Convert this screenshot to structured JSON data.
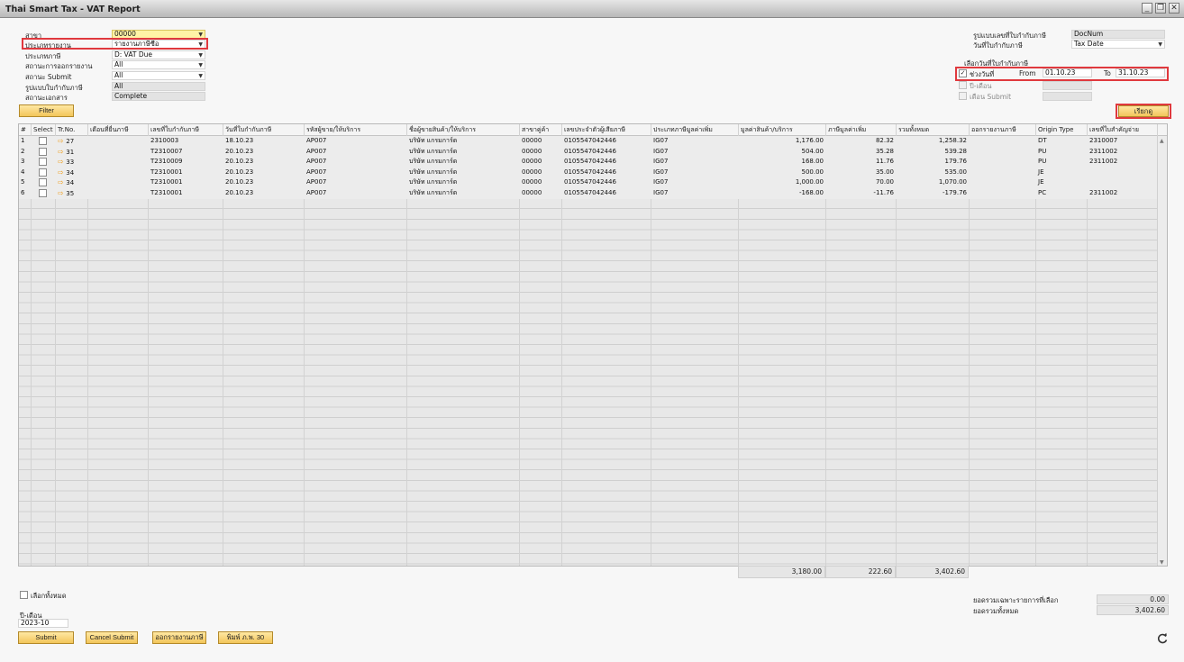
{
  "window": {
    "title": "Thai Smart Tax - VAT Report"
  },
  "left_form": [
    {
      "label": "สาขา",
      "value": "00000",
      "style": "yellow",
      "dropdown": true
    },
    {
      "label": "ประเภทรายงาน",
      "value": "รายงานภาษีซื้อ",
      "style": "white",
      "dropdown": true
    },
    {
      "label": "ประเภทภาษี",
      "value": "D: VAT Due",
      "style": "white",
      "dropdown": true
    },
    {
      "label": "สถานะการออกรายงาน",
      "value": "All",
      "style": "white",
      "dropdown": true
    },
    {
      "label": "สถานะ Submit",
      "value": "All",
      "style": "white",
      "dropdown": true
    },
    {
      "label": "รูปแบบใบกำกับภาษี",
      "value": "All",
      "style": "grey",
      "dropdown": false
    },
    {
      "label": "สถานะเอกสาร",
      "value": "Complete",
      "style": "grey",
      "dropdown": false
    }
  ],
  "right_form": {
    "doc_format_label": "รูปแบบเลขที่ใบกำกับภาษี",
    "doc_format_value": "DocNum",
    "date_label": "วันที่ใบกำกับภาษี",
    "date_value": "Tax Date",
    "select_date_heading": "เลือกวันที่ใบกำกับภาษี",
    "range_label": "ช่วงวันที่",
    "from_label": "From",
    "from_value": "01.10.23",
    "to_label": "To",
    "to_value": "31.10.23",
    "year_month_label": "ปี-เดือน",
    "month_submit_label": "เดือน Submit"
  },
  "buttons": {
    "filter": "Filter",
    "match": "เรียกดู",
    "submit": "Submit",
    "cancel_submit": "Cancel Submit",
    "issue_report": "ออกรายงานภาษี",
    "print_form": "พิมพ์ ภ.พ. 30"
  },
  "table": {
    "columns": [
      "#",
      "Select",
      "Tr.No.",
      "เดือนที่ยื่นภาษี",
      "เลขที่ใบกำกับภาษี",
      "วันที่ใบกำกับภาษี",
      "รหัสผู้ขาย/ให้บริการ",
      "ชื่อผู้ขายสินค้า/ให้บริการ",
      "สาขาคู่ค้า",
      "เลขประจำตัวผู้เสียภาษี",
      "ประเภทภาษีมูลค่าเพิ่ม",
      "มูลค่าสินค้า/บริการ",
      "ภาษีมูลค่าเพิ่ม",
      "รวมทั้งหมด",
      "ออกรายงานภาษี",
      "Origin Type",
      "เลขที่ใบสำคัญจ่าย"
    ],
    "rows": [
      [
        "1",
        "",
        "27",
        "",
        "2310003",
        "18.10.23",
        "AP007",
        "บริษัท แกรมการ์ด",
        "00000",
        "0105547042446",
        "IG07",
        "1,176.00",
        "82.32",
        "1,258.32",
        "",
        "DT",
        "2310007"
      ],
      [
        "2",
        "",
        "31",
        "",
        "T2310007",
        "20.10.23",
        "AP007",
        "บริษัท แกรมการ์ด",
        "00000",
        "0105547042446",
        "IG07",
        "504.00",
        "35.28",
        "539.28",
        "",
        "PU",
        "2311002"
      ],
      [
        "3",
        "",
        "33",
        "",
        "T2310009",
        "20.10.23",
        "AP007",
        "บริษัท แกรมการ์ด",
        "00000",
        "0105547042446",
        "IG07",
        "168.00",
        "11.76",
        "179.76",
        "",
        "PU",
        "2311002"
      ],
      [
        "4",
        "",
        "34",
        "",
        "T2310001",
        "20.10.23",
        "AP007",
        "บริษัท แกรมการ์ด",
        "00000",
        "0105547042446",
        "IG07",
        "500.00",
        "35.00",
        "535.00",
        "",
        "JE",
        ""
      ],
      [
        "5",
        "",
        "34",
        "",
        "T2310001",
        "20.10.23",
        "AP007",
        "บริษัท แกรมการ์ด",
        "00000",
        "0105547042446",
        "IG07",
        "1,000.00",
        "70.00",
        "1,070.00",
        "",
        "JE",
        ""
      ],
      [
        "6",
        "",
        "35",
        "",
        "T2310001",
        "20.10.23",
        "AP007",
        "บริษัท แกรมการ์ด",
        "00000",
        "0105547042446",
        "IG07",
        "-168.00",
        "-11.76",
        "-179.76",
        "",
        "PC",
        "2311002"
      ]
    ],
    "totals": {
      "amount": "3,180.00",
      "vat": "222.60",
      "total": "3,402.60"
    }
  },
  "bottom": {
    "select_all_label": "เลือกทั้งหมด",
    "period_label": "ปี-เดือน",
    "period_value": "2023-10",
    "selected_total_label": "ยอดรวมเฉพาะรายการที่เลือก",
    "selected_total_value": "0.00",
    "grand_total_label": "ยอดรวมทั้งหมด",
    "grand_total_value": "3,402.60"
  },
  "icons": {
    "refresh": "refresh-icon",
    "row_link": "link-arrow-icon",
    "minimize": "minimize-icon",
    "restore": "restore-icon",
    "close": "close-icon"
  },
  "colors": {
    "accent_yellow": "#f2c55a",
    "highlight_red": "#e0393e",
    "link_arrow": "#f0a020"
  }
}
